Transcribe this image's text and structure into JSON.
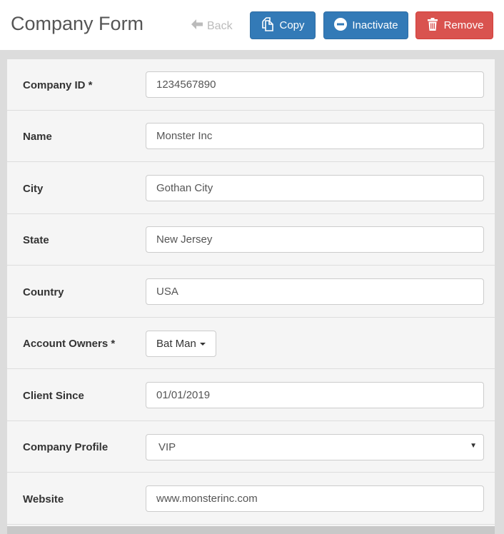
{
  "header": {
    "title": "Company Form",
    "back_label": "Back",
    "copy_label": "Copy",
    "inactivate_label": "Inactivate",
    "remove_label": "Remove"
  },
  "form": {
    "company_id": {
      "label": "Company ID *",
      "value": "1234567890"
    },
    "name": {
      "label": "Name",
      "value": "Monster Inc"
    },
    "city": {
      "label": "City",
      "value": "Gothan City"
    },
    "state": {
      "label": "State",
      "value": "New Jersey"
    },
    "country": {
      "label": "Country",
      "value": "USA"
    },
    "account_owners": {
      "label": "Account Owners *",
      "value": "Bat Man"
    },
    "client_since": {
      "label": "Client Since",
      "value": "01/01/2019"
    },
    "company_profile": {
      "label": "Company Profile",
      "value": "VIP"
    },
    "website": {
      "label": "Website",
      "value": "www.monsterinc.com"
    }
  },
  "colors": {
    "primary": "#337ab7",
    "danger": "#d9534f",
    "disabled_text": "#bbbbbb",
    "panel_bg": "#f5f5f5"
  },
  "icons": {
    "back": "arrow-left-icon",
    "copy": "copy-icon",
    "inactivate": "minus-circle-icon",
    "remove": "trash-icon",
    "dropdown": "caret-down-icon",
    "select": "triangle-down-icon"
  }
}
